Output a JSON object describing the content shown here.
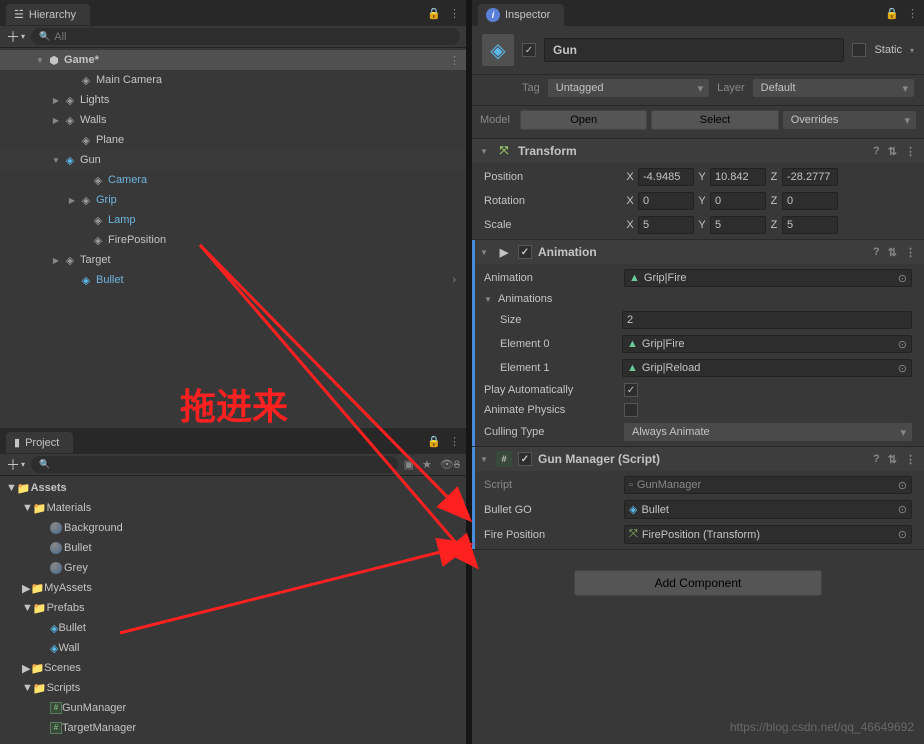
{
  "hierarchy": {
    "title": "Hierarchy",
    "search_placeholder": "All",
    "scene_name": "Game*",
    "items": {
      "main_camera": "Main Camera",
      "lights": "Lights",
      "walls": "Walls",
      "plane": "Plane",
      "gun": "Gun",
      "camera": "Camera",
      "grip": "Grip",
      "lamp": "Lamp",
      "fire_position": "FirePosition",
      "target": "Target",
      "bullet": "Bullet"
    }
  },
  "project": {
    "title": "Project",
    "visibility_count": "8",
    "assets": "Assets",
    "materials": "Materials",
    "background": "Background",
    "bullet": "Bullet",
    "grey": "Grey",
    "my_assets": "MyAssets",
    "prefabs": "Prefabs",
    "pf_bullet": "Bullet",
    "pf_wall": "Wall",
    "scenes": "Scenes",
    "scripts": "Scripts",
    "gun_manager": "GunManager",
    "target_manager": "TargetManager"
  },
  "inspector": {
    "title": "Inspector",
    "obj_name": "Gun",
    "static": "Static",
    "tag_label": "Tag",
    "tag_value": "Untagged",
    "layer_label": "Layer",
    "layer_value": "Default",
    "model_label": "Model",
    "open": "Open",
    "select": "Select",
    "overrides": "Overrides",
    "transform": {
      "title": "Transform",
      "position": "Position",
      "rotation": "Rotation",
      "scale": "Scale",
      "px": "-4.9485",
      "py": "10.842",
      "pz": "-28.2777",
      "rx": "0",
      "ry": "0",
      "rz": "0",
      "sx": "5",
      "sy": "5",
      "sz": "5"
    },
    "animation": {
      "title": "Animation",
      "anim_label": "Animation",
      "anim_value": "Grip|Fire",
      "anims_label": "Animations",
      "size_label": "Size",
      "size_value": "2",
      "el0_label": "Element 0",
      "el0_value": "Grip|Fire",
      "el1_label": "Element 1",
      "el1_value": "Grip|Reload",
      "play_auto": "Play Automatically",
      "anim_physics": "Animate Physics",
      "cull_label": "Culling Type",
      "cull_value": "Always Animate"
    },
    "gun_manager": {
      "title": "Gun Manager (Script)",
      "script_label": "Script",
      "script_value": "GunManager",
      "bullet_label": "Bullet GO",
      "bullet_value": "Bullet",
      "fire_label": "Fire Position",
      "fire_value": "FirePosition (Transform)"
    },
    "add_component": "Add Component"
  },
  "annotation": "拖进来",
  "watermark": "https://blog.csdn.net/qq_46649692"
}
